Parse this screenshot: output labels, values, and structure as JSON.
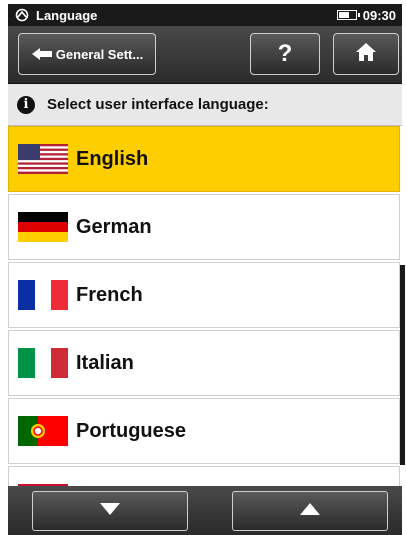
{
  "status_bar": {
    "title": "Language",
    "time": "09:30",
    "battery_level": 0.55
  },
  "toolbar": {
    "back_label": "General Sett...",
    "help_label": "?"
  },
  "info": {
    "text": "Select user interface language:"
  },
  "languages": [
    {
      "label": "English",
      "flag": "us-flag-icon",
      "selected": true
    },
    {
      "label": "German",
      "flag": "de-flag-icon",
      "selected": false
    },
    {
      "label": "French",
      "flag": "fr-flag-icon",
      "selected": false
    },
    {
      "label": "Italian",
      "flag": "it-flag-icon",
      "selected": false
    },
    {
      "label": "Portuguese",
      "flag": "pt-flag-icon",
      "selected": false
    }
  ],
  "colors": {
    "selected_bg": "#ffce00",
    "bar_dark": "#2b2b2b"
  }
}
